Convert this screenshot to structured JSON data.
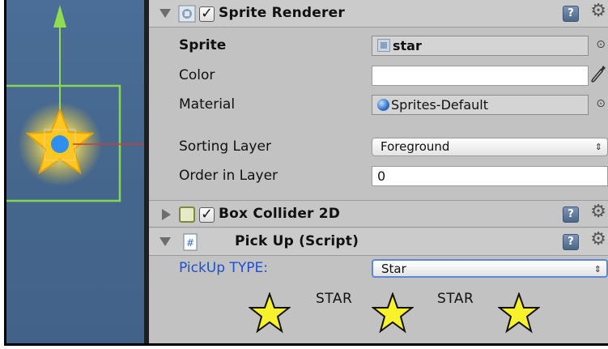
{
  "scene": {
    "handle_color": "#8fdc4f",
    "star_color": "#ffd21f",
    "pivot_color": "#2f8ff0"
  },
  "sprite_renderer": {
    "title": "Sprite Renderer",
    "enabled": true,
    "fields": {
      "sprite": {
        "label": "Sprite",
        "value": "star"
      },
      "color": {
        "label": "Color",
        "value": "#ffffff"
      },
      "material": {
        "label": "Material",
        "value": "Sprites-Default"
      },
      "sorting_layer": {
        "label": "Sorting Layer",
        "value": "Foreground"
      },
      "order_in_layer": {
        "label": "Order in Layer",
        "value": "0"
      }
    }
  },
  "box_collider": {
    "title": "Box Collider 2D",
    "enabled": true
  },
  "pickup_script": {
    "title": "Pick Up (Script)",
    "type_label": "PickUp TYPE:",
    "type_value": "Star",
    "star_labels": [
      "STAR",
      "STAR"
    ]
  },
  "icons": {
    "help": "?",
    "gear": "⚙",
    "checkmark": "✓",
    "object_picker": "⊙",
    "popup_arrows": "⇕"
  },
  "colors": {
    "label_blue": "#1b4fd6",
    "star_fill": "#f7f22a"
  }
}
